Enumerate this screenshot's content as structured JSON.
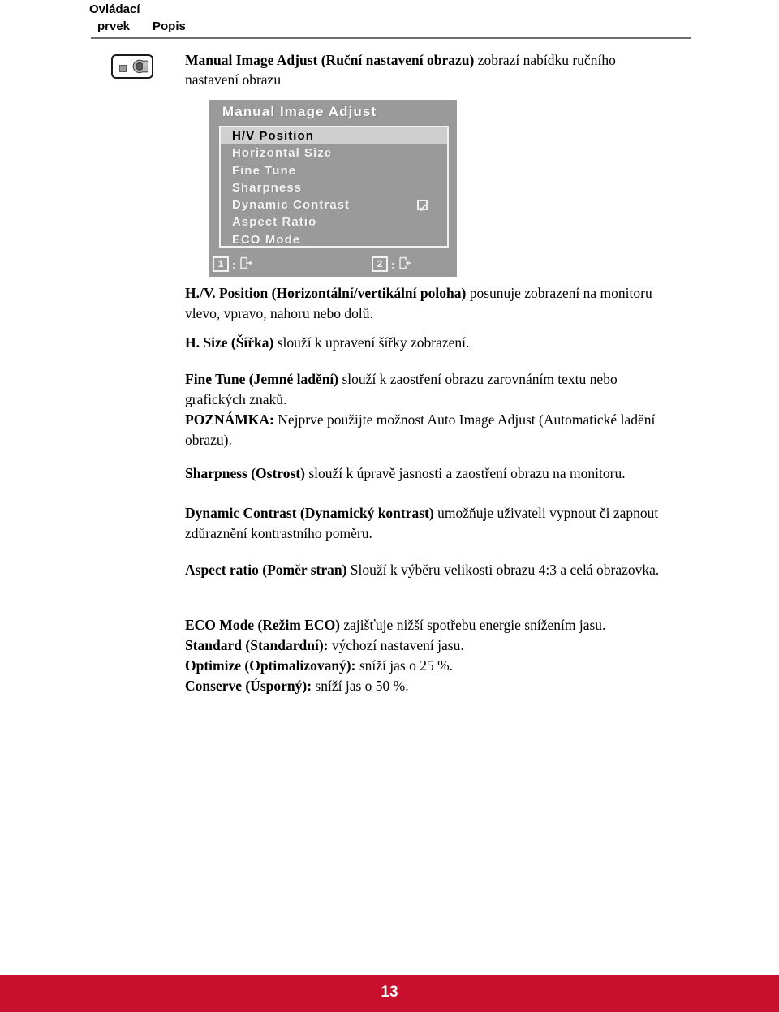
{
  "header": {
    "col_control_line1": "Ovládací",
    "col_control_line2": "prvek",
    "col_description": "Popis"
  },
  "icon": {
    "name": "wrench-icon",
    "alt": "Manual Image Adjust button icon"
  },
  "intro": {
    "bold": "Manual Image Adjust (Ruční nastavení obrazu)",
    "rest": " zobrazí nabídku ručního nastavení obrazu"
  },
  "osd": {
    "title": "Manual Image Adjust",
    "items": [
      {
        "label": "H/V Position",
        "selected": true,
        "checkbox": false
      },
      {
        "label": "Horizontal Size",
        "selected": false,
        "checkbox": false
      },
      {
        "label": "Fine Tune",
        "selected": false,
        "checkbox": false
      },
      {
        "label": "Sharpness",
        "selected": false,
        "checkbox": false
      },
      {
        "label": "Dynamic Contrast",
        "selected": false,
        "checkbox": true
      },
      {
        "label": "Aspect Ratio",
        "selected": false,
        "checkbox": false
      },
      {
        "label": "ECO Mode",
        "selected": false,
        "checkbox": false
      }
    ],
    "footer": {
      "key1": "1",
      "key1_sep": ":",
      "key2": "2",
      "key2_sep": ":"
    },
    "colors": {
      "background": "#9a9a9a",
      "selected_row": "#cfcfcf",
      "text": "#f4f4f4",
      "selected_text": "#000000"
    }
  },
  "paragraphs": {
    "hv": {
      "bold": "H./V. Position (Horizontální/vertikální poloha)",
      "rest": " posunuje zobrazení na monitoru vlevo, vpravo, nahoru nebo dolů."
    },
    "hsize": {
      "bold": "H. Size (Šířka)",
      "rest": " slouží k upravení šířky zobrazení."
    },
    "finetune": {
      "bold": "Fine Tune (Jemné ladění)",
      "rest": " slouží k zaostření obrazu zarovnáním textu nebo grafických znaků.",
      "note_bold": "POZNÁMKA:",
      "note_rest": " Nejprve použijte možnost Auto Image Adjust (Automatické ladění obrazu)."
    },
    "sharpness": {
      "bold": "Sharpness (Ostrost)",
      "rest": " slouží k úpravě jasnosti a zaostření obrazu na monitoru."
    },
    "dynamic": {
      "bold": "Dynamic Contrast (Dynamický kontrast)",
      "rest": " umožňuje uživateli vypnout či zapnout zdůraznění kontrastního poměru."
    },
    "aspect": {
      "bold": "Aspect ratio (Poměr stran)",
      "rest": " Slouží k výběru velikosti obrazu 4:3  a celá obrazovka."
    },
    "eco": {
      "bold": "ECO Mode (Režim ECO)",
      "rest": " zajišťuje nižší spotřebu energie snížením jasu.",
      "standard_bold": "Standard (Standardní):",
      "standard_rest": " výchozí nastavení jasu.",
      "optimize_bold": "Optimize (Optimalizovaný):",
      "optimize_rest": " sníží jas o 25 %.",
      "conserve_bold": "Conserve (Úsporný):",
      "conserve_rest": " sníží jas o 50 %."
    }
  },
  "footer": {
    "page_number": "13",
    "bar_color": "#c8102e"
  }
}
